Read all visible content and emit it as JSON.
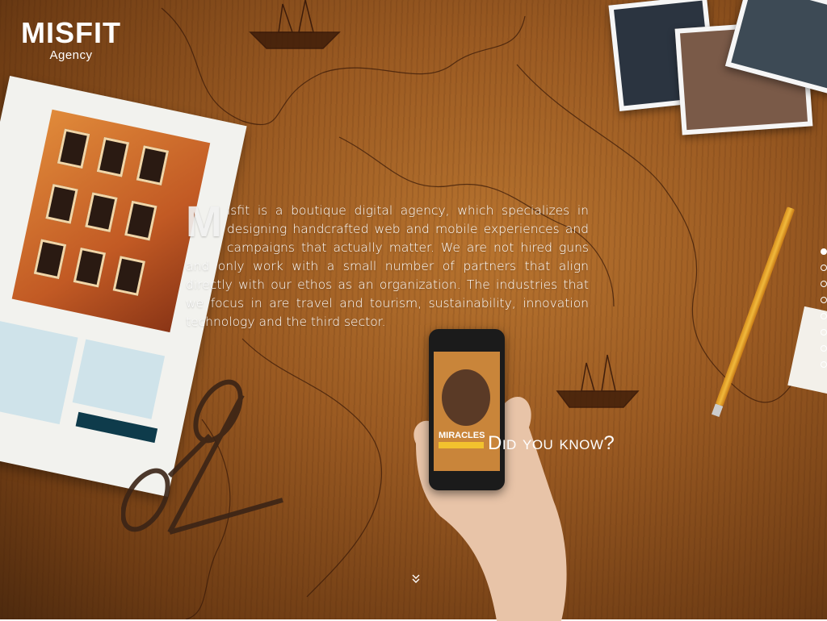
{
  "brand": {
    "name": "MISFIT",
    "tagline": "Agency"
  },
  "intro": {
    "drop_cap": "M",
    "text": "isfit is a boutique digital agency, which specializes in designing handcrafted web and mobile experiences and campaigns that actually matter. We are not hired guns and only work with a small number of partners that align directly with our ethos as an organization. The industries that we focus in are travel and tourism, sustainability, innovation technology and the third sector."
  },
  "cta": {
    "did_you_know": "Did you know?"
  },
  "phone": {
    "headline": "MIRACLES"
  },
  "pager": {
    "dots": [
      true,
      false,
      false,
      false,
      false,
      false,
      false,
      false
    ]
  },
  "icons": {
    "scroll_down": "double-chevron-down-icon"
  }
}
